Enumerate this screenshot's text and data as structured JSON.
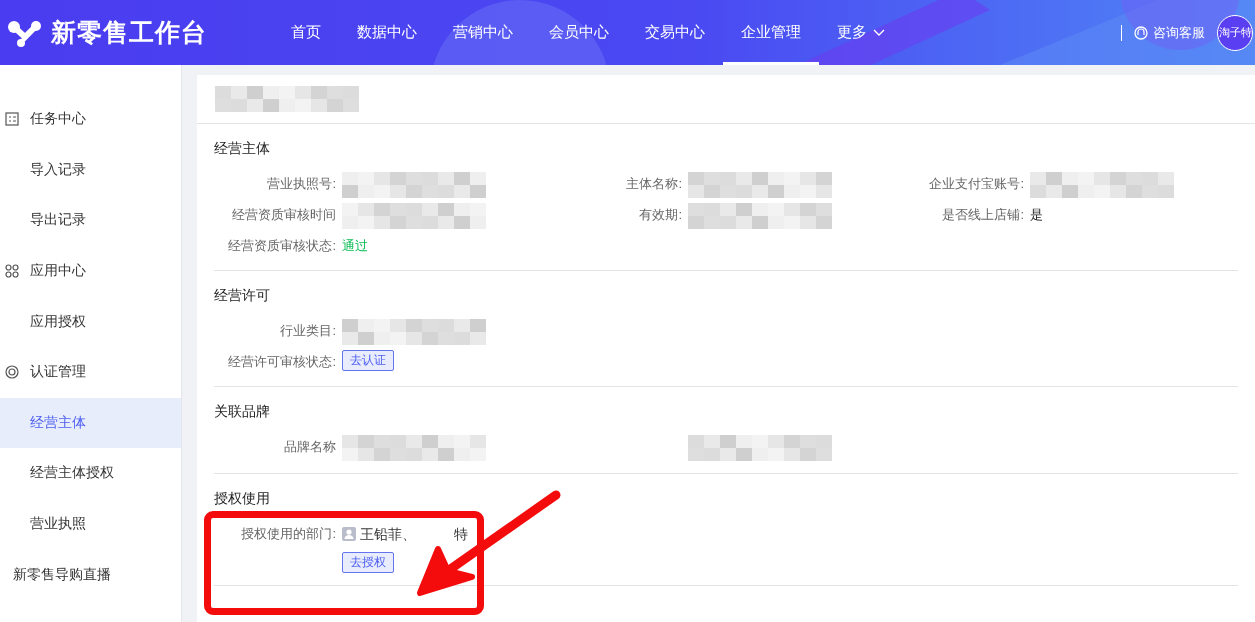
{
  "header": {
    "logo_text": "新零售工作台",
    "nav": [
      {
        "label": "首页",
        "selected": false
      },
      {
        "label": "数据中心",
        "selected": false
      },
      {
        "label": "营销中心",
        "selected": false
      },
      {
        "label": "会员中心",
        "selected": false
      },
      {
        "label": "交易中心",
        "selected": false
      },
      {
        "label": "企业管理",
        "selected": true
      },
      {
        "label": "更多",
        "selected": false,
        "kind": "dropdown"
      }
    ],
    "service": "咨询客服",
    "avatar_text": "淘子特"
  },
  "sidebar": {
    "items": [
      {
        "label": "任务中心",
        "kind": "group",
        "selected": false
      },
      {
        "label": "导入记录",
        "kind": "item",
        "selected": false
      },
      {
        "label": "导出记录",
        "kind": "item",
        "selected": false
      },
      {
        "label": "应用中心",
        "kind": "group",
        "selected": false
      },
      {
        "label": "应用授权",
        "kind": "item",
        "selected": false
      },
      {
        "label": "认证管理",
        "kind": "group",
        "selected": false
      },
      {
        "label": "经营主体",
        "kind": "item",
        "selected": true
      },
      {
        "label": "经营主体授权",
        "kind": "item",
        "selected": false
      },
      {
        "label": "营业执照",
        "kind": "item",
        "selected": false
      },
      {
        "label": "新零售导购直播",
        "kind": "plain-group",
        "selected": false
      }
    ]
  },
  "panel": {
    "title": {
      "kind": "redacted"
    },
    "sections": [
      {
        "title": "经营主体",
        "kind": "grid",
        "fields": [
          {
            "label": "营业执照号:",
            "value": {
              "kind": "redacted"
            }
          },
          {
            "label": "主体名称:",
            "value": {
              "kind": "redacted"
            }
          },
          {
            "label": "企业支付宝账号:",
            "value": {
              "kind": "redacted"
            }
          },
          {
            "label": "经营资质审核时间",
            "value": {
              "kind": "redacted"
            }
          },
          {
            "label": "有效期:",
            "value": {
              "kind": "redacted"
            }
          },
          {
            "label": "是否线上店铺:",
            "value": {
              "kind": "text",
              "text": "是"
            }
          },
          {
            "label": "经营资质审核状态:",
            "value": {
              "kind": "status",
              "text": "通过"
            }
          }
        ]
      },
      {
        "title": "经营许可",
        "kind": "list",
        "fields": [
          {
            "label": "行业类目:",
            "value": {
              "kind": "redacted"
            }
          },
          {
            "label": "经营许可审核状态:",
            "value": {
              "kind": "button",
              "text": "去认证"
            }
          }
        ]
      },
      {
        "title": "关联品牌",
        "kind": "grid",
        "fields": [
          {
            "label": "品牌名称",
            "value": {
              "kind": "redacted"
            }
          },
          {
            "value": {
              "kind": "redacted"
            }
          }
        ]
      },
      {
        "title": "授权使用",
        "kind": "list",
        "fields": [
          {
            "label": "授权使用的部门:",
            "value": {
              "kind": "people",
              "parts": [
                "王铅菲、",
                "特"
              ],
              "button": "去授权"
            }
          }
        ]
      }
    ]
  },
  "annotation": {
    "kind": "box-arrow"
  }
}
